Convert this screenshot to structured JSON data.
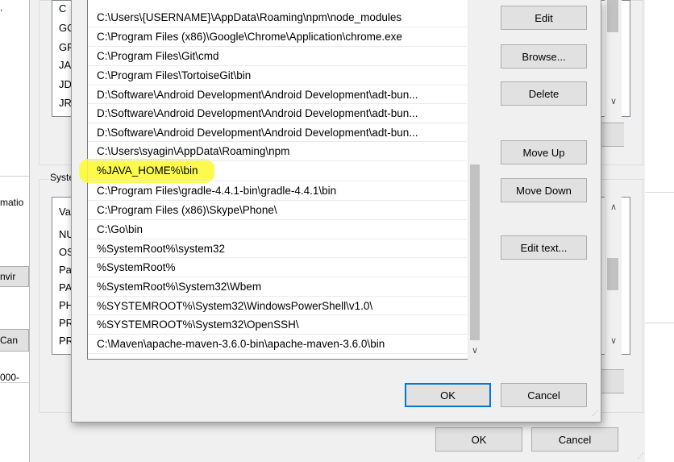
{
  "background_window": {
    "top_fragment": ", ",
    "matio_fragment": "matio",
    "envir_button_fragment": "nvir",
    "cancel_button_fragment": "Can",
    "number_fragment": "000-"
  },
  "env_dialog": {
    "user_list_fragments": [
      "C",
      "GC",
      "GF",
      "JA",
      "JD",
      "JR"
    ],
    "system_group_label": "Syste",
    "system_list_fragments": [
      "Va",
      "NU",
      "OS",
      "Pa",
      "PA",
      "PH",
      "PR",
      "PR"
    ],
    "ok_label": "OK",
    "cancel_label": "Cancel"
  },
  "edit_dialog": {
    "path_entries": [
      "C:\\Users\\{USERNAME}\\AppData\\Roaming\\npm\\node_modules",
      "C:\\Program Files (x86)\\Google\\Chrome\\Application\\chrome.exe",
      "C:\\Program Files\\Git\\cmd",
      "C:\\Program Files\\TortoiseGit\\bin",
      "D:\\Software\\Android Development\\Android Development\\adt-bun...",
      "D:\\Software\\Android Development\\Android Development\\adt-bun...",
      "D:\\Software\\Android Development\\Android Development\\adt-bun...",
      "C:\\Users\\syagin\\AppData\\Roaming\\npm",
      "%JAVA_HOME%\\bin",
      "C:\\Program Files\\gradle-4.4.1-bin\\gradle-4.4.1\\bin",
      "C:\\Program Files (x86)\\Skype\\Phone\\",
      "C:\\Go\\bin",
      "%SystemRoot%\\system32",
      "%SystemRoot%",
      "%SystemRoot%\\System32\\Wbem",
      "%SYSTEMROOT%\\System32\\WindowsPowerShell\\v1.0\\",
      "%SYSTEMROOT%\\System32\\OpenSSH\\",
      "C:\\Maven\\apache-maven-3.6.0-bin\\apache-maven-3.6.0\\bin"
    ],
    "highlighted_entry": "%JAVA_HOME%\\bin",
    "highlight_color": "#fbf93a",
    "buttons": {
      "edit": "Edit",
      "browse": "Browse...",
      "delete": "Delete",
      "move_up": "Move Up",
      "move_down": "Move Down",
      "edit_text": "Edit text...",
      "ok": "OK",
      "cancel": "Cancel"
    },
    "default_button_color": "#0078d7"
  }
}
